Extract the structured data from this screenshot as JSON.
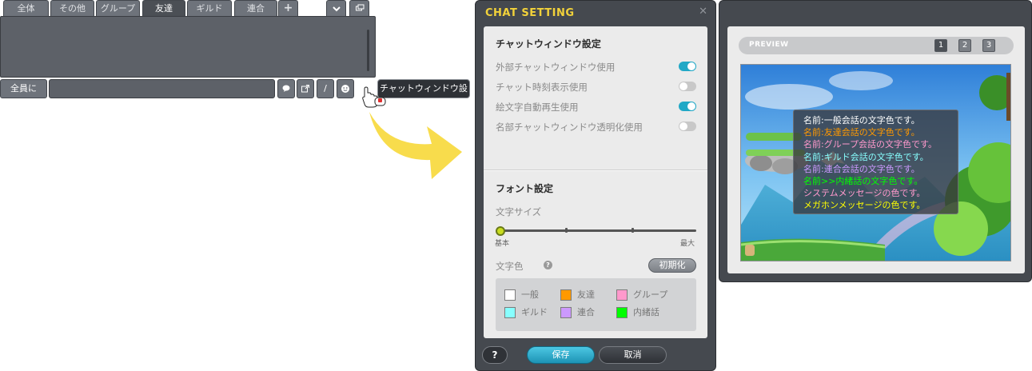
{
  "chat_window": {
    "tabs": [
      {
        "label": "全体",
        "active": false
      },
      {
        "label": "その他",
        "active": false
      },
      {
        "label": "グループ",
        "active": false
      },
      {
        "label": "友達",
        "active": true
      },
      {
        "label": "ギルド",
        "active": false
      },
      {
        "label": "連合",
        "active": false
      }
    ],
    "add_tab_icon": "plus-icon",
    "collapse_icon": "chevron-down-icon",
    "window_icon": "window-icon",
    "target_label": "全員に",
    "input_value": "",
    "buttons": {
      "speech_icon": "speech-bubble-icon",
      "external_icon": "external-link-icon",
      "slash_label": "/",
      "emoji_icon": "smiley-icon",
      "settings_icon": "gear-icon"
    },
    "tooltip": "チャットウィンドウ設定"
  },
  "settings_dialog": {
    "title": "CHAT SETTING",
    "close_icon": "close-icon",
    "window_section": {
      "title": "チャットウィンドウ設定",
      "options": [
        {
          "label": "外部チャットウィンドウ使用",
          "on": true
        },
        {
          "label": "チャット時刻表示使用",
          "on": false
        },
        {
          "label": "絵文字自動再生使用",
          "on": true
        },
        {
          "label": "名部チャットウィンドウ透明化使用",
          "on": false
        }
      ]
    },
    "font_section": {
      "title": "フォント設定",
      "size_label": "文字サイズ",
      "size_min": "基本",
      "size_max": "最大",
      "size_level": 0,
      "size_steps": 4,
      "color_label": "文字色",
      "help_icon": "question-icon",
      "help_glyph": "?",
      "reset_label": "初期化",
      "colors": [
        {
          "label": "一般",
          "color": "#ffffff"
        },
        {
          "label": "友達",
          "color": "#ff9900"
        },
        {
          "label": "グループ",
          "color": "#ff99cc"
        },
        {
          "label": "ギルド",
          "color": "#88ffff"
        },
        {
          "label": "連合",
          "color": "#cc99ff"
        },
        {
          "label": "内緒話",
          "color": "#00ff00"
        }
      ]
    },
    "footer": {
      "help_label": "?",
      "save_label": "保存",
      "cancel_label": "取消"
    }
  },
  "preview": {
    "title": "PREVIEW",
    "pages": [
      {
        "label": "1",
        "active": true
      },
      {
        "label": "2",
        "active": false
      },
      {
        "label": "3",
        "active": false
      }
    ],
    "lines": [
      {
        "text": "名前:一般会話の文字色です。",
        "color": "#ffffff"
      },
      {
        "text": "名前:友達会話の文字色です。",
        "color": "#ff9900"
      },
      {
        "text": "名前:グループ会話の文字色です。",
        "color": "#ff99cc"
      },
      {
        "text": "名前:ギルド会話の文字色です。",
        "color": "#88ffff"
      },
      {
        "text": "名前:連合会話の文字色です。",
        "color": "#cc99ff"
      },
      {
        "text": "名前>>内緒話の文字色です。",
        "color": "#00ff00"
      },
      {
        "text": "システムメッセージの色です。",
        "color": "#ff99cc"
      },
      {
        "text": "メガホンメッセージの色です。",
        "color": "#ffff00"
      }
    ]
  },
  "colors": {
    "accent": "#21a8c6",
    "title": "#f2d23a",
    "panel": "#45494f"
  }
}
